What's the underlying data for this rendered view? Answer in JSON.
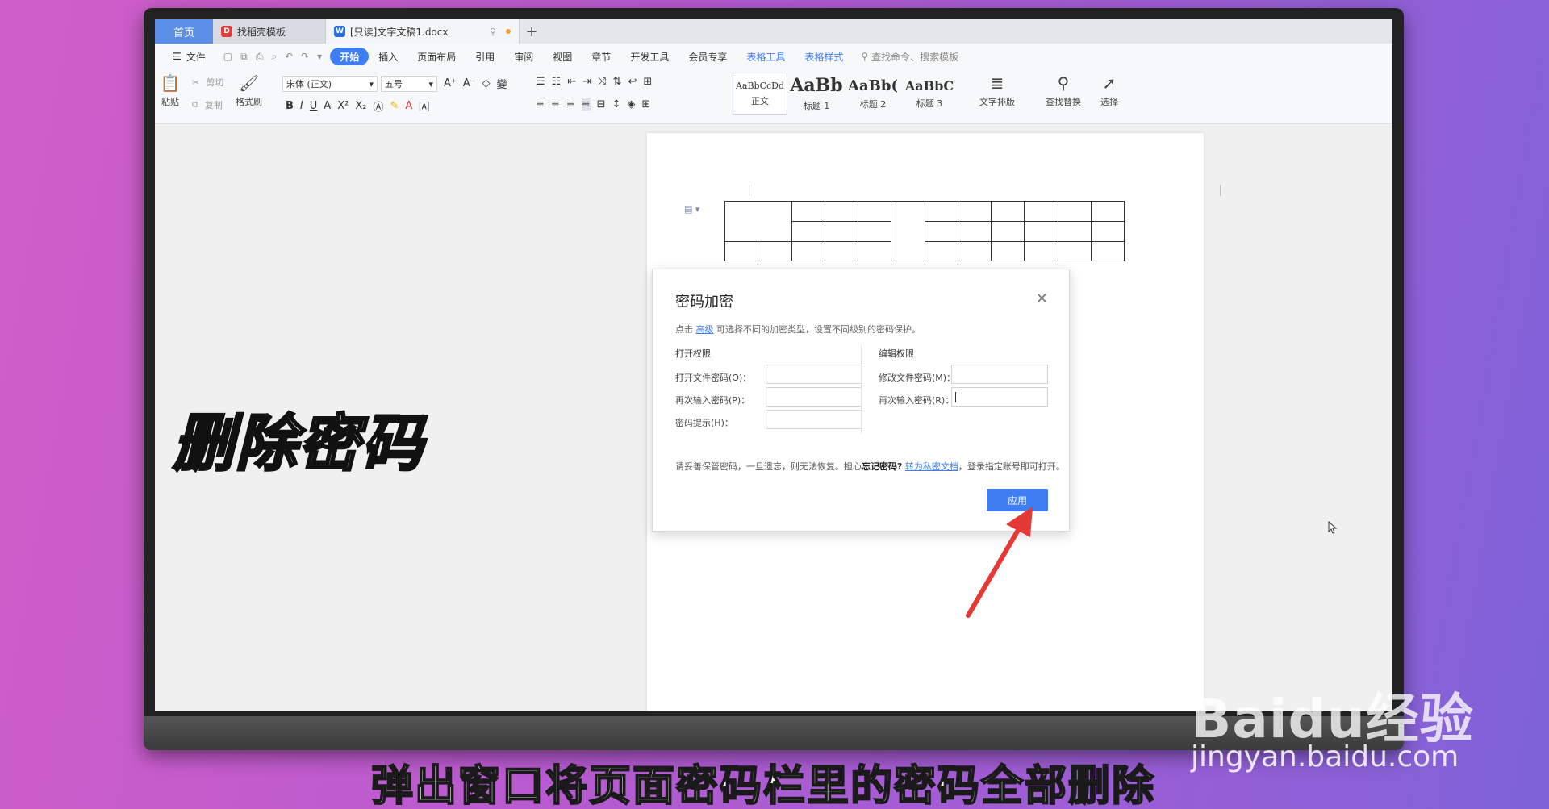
{
  "tabs": {
    "home": "首页",
    "template": "找稻壳模板",
    "document": "[只读]文字文稿1.docx",
    "new_tab": "+"
  },
  "menu": {
    "file": "文件",
    "items": [
      "开始",
      "插入",
      "页面布局",
      "引用",
      "审阅",
      "视图",
      "章节",
      "开发工具",
      "会员专享"
    ],
    "table_tools": "表格工具",
    "table_style": "表格样式",
    "search": "查找命令、搜索模板"
  },
  "ribbon": {
    "paste": "粘贴",
    "cut": "剪切",
    "copy": "复制",
    "format_painter": "格式刷",
    "font_name": "宋体 (正文)",
    "font_size": "五号",
    "styles": [
      {
        "preview": "AaBbCcDd",
        "label": "正文"
      },
      {
        "preview": "AaBb",
        "label": "标题 1"
      },
      {
        "preview": "AaBb(",
        "label": "标题 2"
      },
      {
        "preview": "AaBbC",
        "label": "标题 3"
      }
    ],
    "text_layout": "文字排版",
    "find_replace": "查找替换",
    "select": "选择"
  },
  "dialog": {
    "title": "密码加密",
    "hint_prefix": "点击",
    "hint_link": "高级",
    "hint_suffix": "可选择不同的加密类型，设置不同级别的密码保护。",
    "open_section": "打开权限",
    "edit_section": "编辑权限",
    "open_password": "打开文件密码(O)：",
    "open_confirm": "再次输入密码(P)：",
    "password_hint": "密码提示(H)：",
    "edit_password": "修改文件密码(M)：",
    "edit_confirm": "再次输入密码(R)：",
    "warn_prefix": "请妥善保管密码，一旦遗忘，则无法恢复。担心",
    "warn_bold": "忘记密码?",
    "warn_link": "转为私密文档",
    "warn_suffix": "，登录指定账号即可打开。",
    "apply": "应用"
  },
  "overlay": {
    "label": "删除密码",
    "caption": "弹出窗口将页面密码栏里的密码全部删除",
    "watermark": "Baidu经验",
    "watermark_url": "jingyan.baidu.com"
  },
  "colors": {
    "accent": "#3f7df2",
    "arrow": "#e53935"
  }
}
